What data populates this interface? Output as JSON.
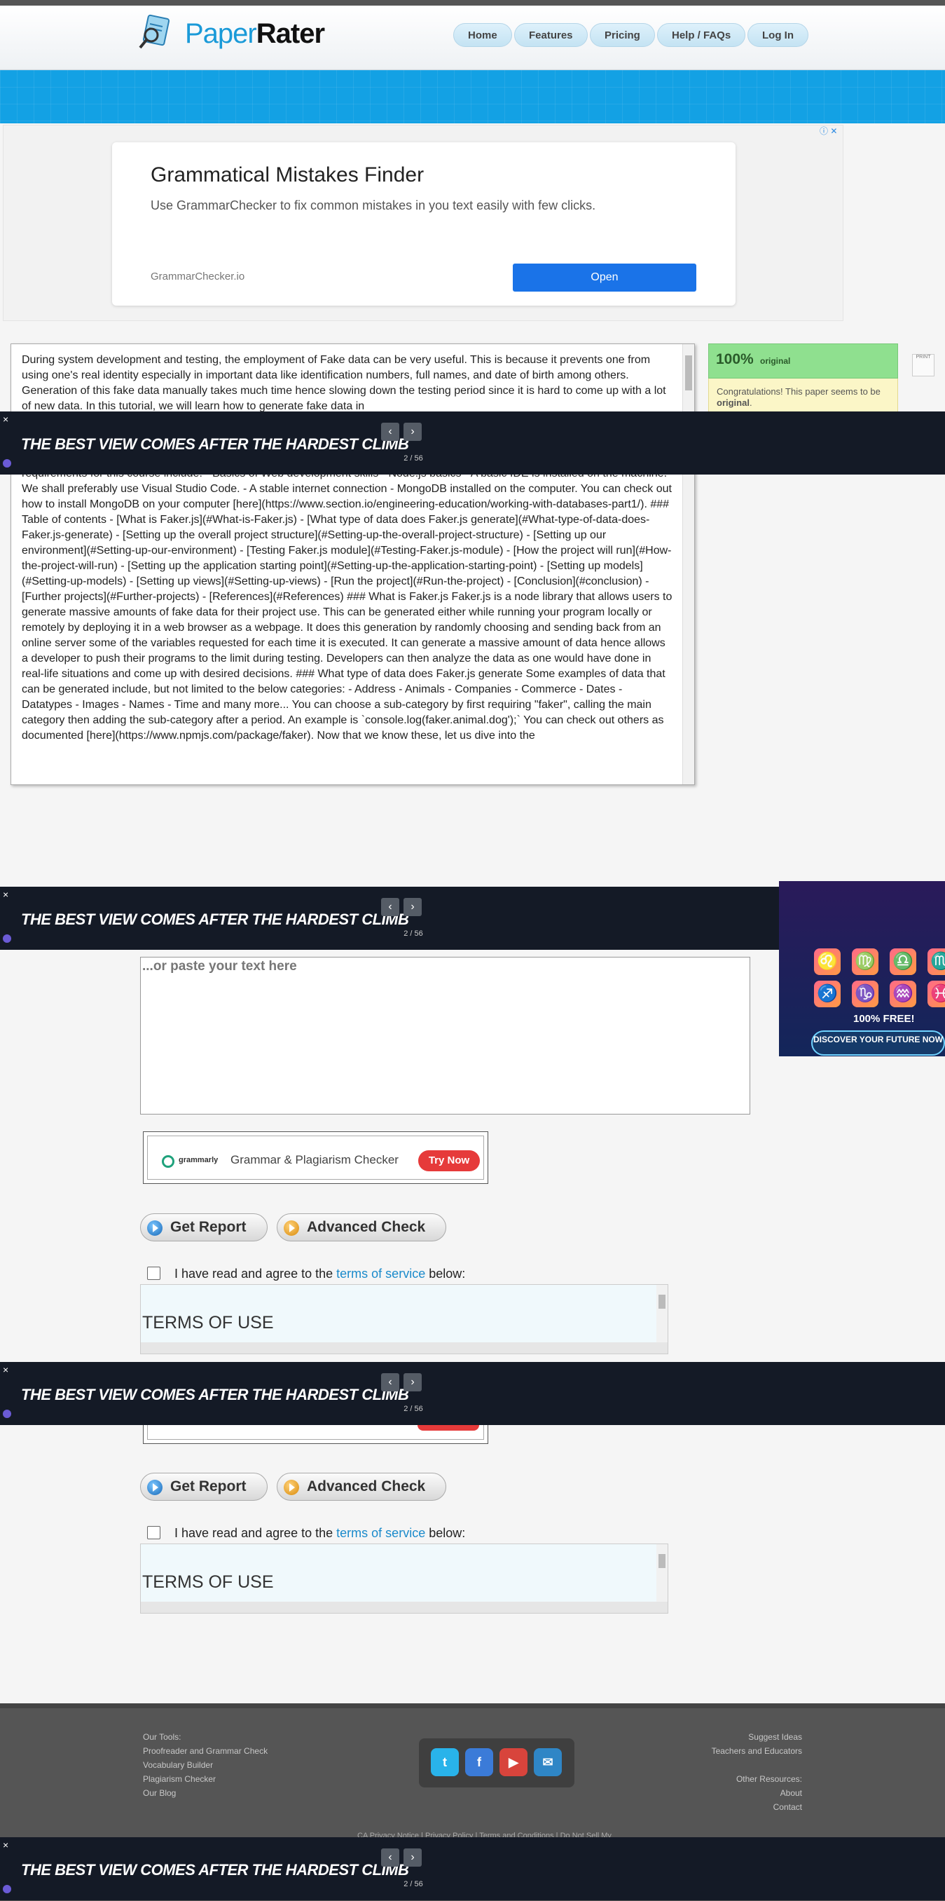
{
  "header": {
    "logo_part1": "Paper",
    "logo_part2": "Rater",
    "nav": [
      "Home",
      "Features",
      "Pricing",
      "Help / FAQs",
      "Log In"
    ]
  },
  "ad": {
    "title": "Grammatical Mistakes Finder",
    "description": "Use GrammarChecker to fix common mistakes in you text easily with few clicks.",
    "domain": "GrammarChecker.io",
    "button": "Open"
  },
  "essay": {
    "text_top": "During system development and testing, the employment of Fake data can be very useful. This is because it prevents one from using one's real identity especially in important data like identification numbers, full names, and date of birth among others. Generation of this fake data manually takes much time hence slowing down the testing period since it is hard to come up with a lot of new data. In this tutorial, we will learn how to generate fake data in",
    "text_main": "requirements for this course include: - Basics of Web development skills - Node.js basics - A basic IDE is installed on the machine. We shall preferably use Visual Studio Code. - A stable internet connection - MongoDB installed on the computer. You can check out how to install MongoDB on your computer [here](https://www.section.io/engineering-education/working-with-databases-part1/). ### Table of contents - [What is Faker.js](#What-is-Faker.js) - [What type of data does Faker.js generate](#What-type-of-data-does-Faker.js-generate) - [Setting up the overall project structure](#Setting-up-the-overall-project-structure) - [Setting up our environment](#Setting-up-our-environment) - [Testing Faker.js module](#Testing-Faker.js-module) - [How the project will run](#How-the-project-will-run) - [Setting up the application starting point](#Setting-up-the-application-starting-point) - [Setting up models](#Setting-up-models) - [Setting up views](#Setting-up-views) - [Run the project](#Run-the-project) - [Conclusion](#conclusion) - [Further projects](#Further-projects) - [References](#References) ### What is Faker.js Faker.js is a node library that allows users to generate massive amounts of fake data for their project use. This can be generated either while running your program locally or remotely by deploying it in a web browser as a webpage. It does this generation by randomly choosing and sending back from an online server some of the variables requested for each time it is executed. It can generate a massive amount of data hence allows a developer to push their programs to the limit during testing. Developers can then analyze the data as one would have done in real-life situations and come up with desired decisions. ### What type of data does Faker.js generate Some examples of data that can be generated include, but not limited to the below categories: - Address - Animals - Companies - Commerce - Dates - Datatypes - Images - Names - Time and many more... You can choose a sub-category by first requiring \"faker\", calling the main category then adding the sub-category after a period. An example is `console.log(faker.animal.dog');` You can check out others as documented [here](https://www.npmjs.com/package/faker). Now that we know these, let us dive into the"
  },
  "score": {
    "percent": "100%",
    "label": "original",
    "message_prefix": "Congratulations! This paper seems to be ",
    "message_bold": "original",
    "message_suffix": "."
  },
  "print_label": "PRINT",
  "banner": {
    "title": "THE BEST VIEW COMES AFTER THE HARDEST CLIMB",
    "counter": "2 / 56",
    "prev": "‹",
    "next": "›",
    "close": "×"
  },
  "zodiac_ad": {
    "signs": [
      "♌",
      "♍",
      "♎",
      "♏",
      "♐",
      "♑",
      "♒",
      "♓"
    ],
    "free_text": "100% FREE!",
    "cta": "DISCOVER YOUR FUTURE NOW"
  },
  "paste": {
    "placeholder": "...or paste your text here"
  },
  "grammarly": {
    "brand": "grammarly",
    "text": "Grammar & Plagiarism Checker",
    "button": "Try Now"
  },
  "actions": {
    "get_report": "Get Report",
    "advanced_check": "Advanced Check"
  },
  "agree": {
    "prefix": "I have read and agree to the ",
    "link": "terms of service",
    "suffix": " below:"
  },
  "terms": {
    "title": "TERMS OF USE"
  },
  "footer": {
    "tools_heading": "Our Tools:",
    "tools": [
      "Proofreader and Grammar Check",
      "Vocabulary Builder",
      "Plagiarism Checker",
      "Our Blog"
    ],
    "right_links_1": [
      "Suggest Ideas",
      "Teachers and Educators"
    ],
    "resources_heading": "Other Resources:",
    "right_links_2": [
      "About",
      "Contact"
    ],
    "copyright": "CA Privacy Notice | Privacy Policy | Terms and Conditions | Do Not Sell My"
  },
  "colors": {
    "brand_blue": "#1a9ad8",
    "score_green": "#8fe08f",
    "banner_bg": "#141a26",
    "link": "#1a8acb"
  }
}
